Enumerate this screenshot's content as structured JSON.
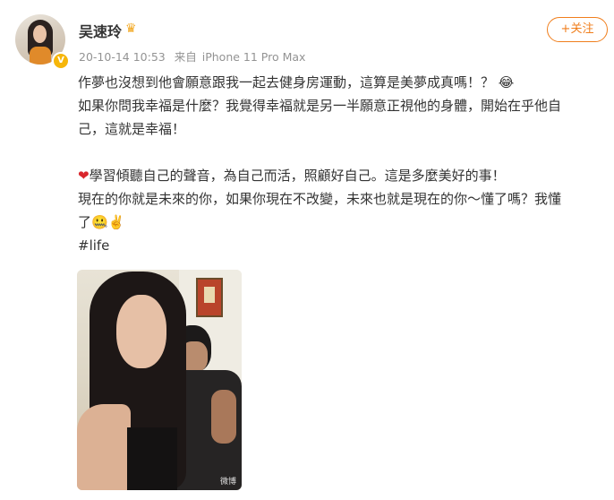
{
  "post": {
    "author": {
      "name": "吴速玲",
      "verified_badge": "V",
      "crown_icon": "crown-icon"
    },
    "time": "20-10-14 10:53",
    "source_prefix": "来自",
    "source_device": "iPhone 11 Pro Max",
    "follow_label": "+关注",
    "lines": {
      "l1": "作夢也沒想到他會願意跟我一起去健身房運動，這算是美夢成真嗎！？",
      "l1_emoji": "😂",
      "l2": "如果你問我幸福是什麼？我覺得幸福就是另一半願意正視他的身體，開始在乎他自",
      "l3": "己，這就是幸福！",
      "l4_emoji": "❤",
      "l4": "學習傾聽自己的聲音，為自己而活，照顧好自己。這是多麼美好的事！",
      "l5": "現在的你就是未來的你，如果你現在不改變，未來也就是現在的你～懂了嗎？我懂",
      "l6": "了",
      "l6_emoji": "🤐✌️",
      "hashtag": "#life"
    },
    "photo_watermark": "微博"
  },
  "colors": {
    "accent": "#f07e1c",
    "meta": "#939393",
    "text": "#333333"
  }
}
